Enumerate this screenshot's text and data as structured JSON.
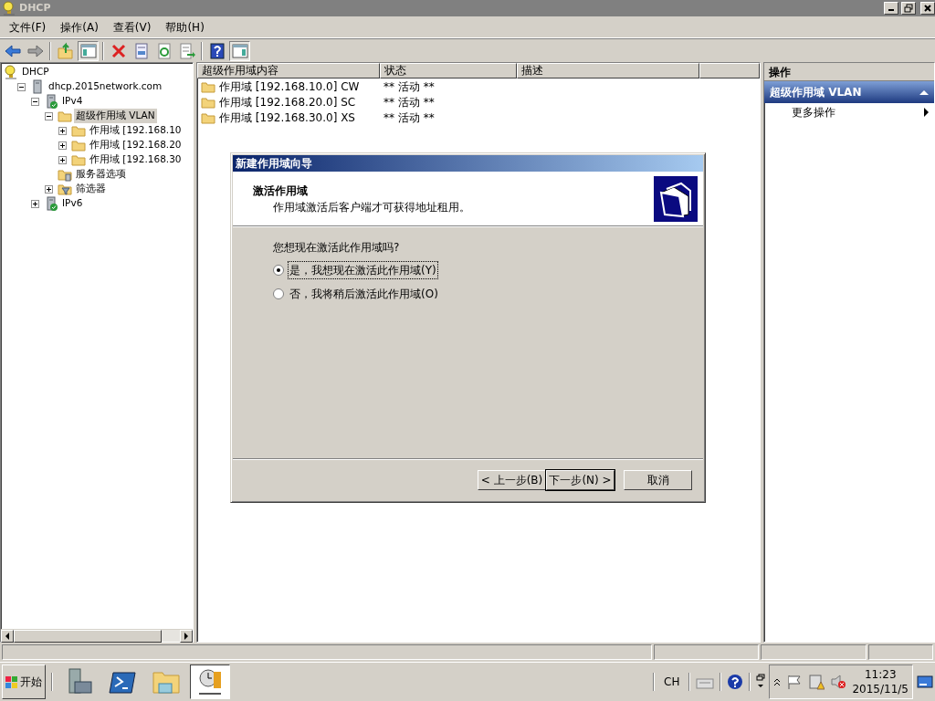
{
  "window": {
    "title": "DHCP"
  },
  "menu": [
    "文件(F)",
    "操作(A)",
    "查看(V)",
    "帮助(H)"
  ],
  "toolbar": [
    {
      "kind": "back",
      "pressed": false
    },
    {
      "kind": "forward",
      "pressed": false
    },
    {
      "kind": "sep"
    },
    {
      "kind": "up",
      "pressed": false
    },
    {
      "kind": "tree",
      "pressed": true
    },
    {
      "kind": "sep"
    },
    {
      "kind": "delete",
      "pressed": false
    },
    {
      "kind": "properties",
      "pressed": false
    },
    {
      "kind": "refresh",
      "pressed": false
    },
    {
      "kind": "export",
      "pressed": false
    },
    {
      "kind": "sep"
    },
    {
      "kind": "help",
      "pressed": false
    },
    {
      "kind": "actionpane",
      "pressed": true
    }
  ],
  "tree": [
    {
      "label": "DHCP",
      "kind": "dhcp",
      "selected": false,
      "children": [
        {
          "label": "dhcp.2015network.com",
          "kind": "server",
          "expanded": true,
          "selected": false,
          "children": [
            {
              "label": "IPv4",
              "kind": "serverok",
              "expanded": true,
              "selected": false,
              "children": [
                {
                  "label": "超级作用域 VLAN",
                  "kind": "folder",
                  "expanded": true,
                  "selected": true,
                  "children": [
                    {
                      "label": "作用域 [192.168.10",
                      "kind": "folder",
                      "expanded": false,
                      "selected": false
                    },
                    {
                      "label": "作用域 [192.168.20",
                      "kind": "folder",
                      "expanded": false,
                      "selected": false
                    },
                    {
                      "label": "作用域 [192.168.30",
                      "kind": "folder",
                      "expanded": false,
                      "selected": false
                    }
                  ]
                },
                {
                  "label": "服务器选项",
                  "kind": "options",
                  "selected": false
                },
                {
                  "label": "筛选器",
                  "kind": "filter",
                  "expanded": false,
                  "selected": false
                }
              ]
            },
            {
              "label": "IPv6",
              "kind": "serverok",
              "expanded": false,
              "selected": false
            }
          ]
        }
      ]
    }
  ],
  "list": {
    "columns": [
      "超级作用域内容",
      "状态",
      "描述"
    ],
    "rows": [
      {
        "name": "作用域 [192.168.10.0] CW",
        "status": "** 活动 **"
      },
      {
        "name": "作用域 [192.168.20.0] SC",
        "status": "** 活动 **"
      },
      {
        "name": "作用域 [192.168.30.0] XS",
        "status": "** 活动 **"
      }
    ]
  },
  "actions": {
    "title": "操作",
    "sections": [
      {
        "title": "超级作用域 VLAN",
        "expanded": true,
        "items": [
          "更多操作"
        ]
      }
    ]
  },
  "dialog": {
    "title": "新建作用域向导",
    "heading": "激活作用域",
    "subtitle": "作用域激活后客户端才可获得地址租用。",
    "question": "您想现在激活此作用域吗?",
    "options": [
      {
        "label": "是，我想现在激活此作用域(Y)",
        "selected": true,
        "focused": true
      },
      {
        "label": "否，我将稍后激活此作用域(O)",
        "selected": false,
        "focused": false
      }
    ],
    "buttons": [
      {
        "label": "< 上一步(B)",
        "default": false
      },
      {
        "label": "下一步(N) >",
        "default": true
      },
      {
        "label": "取消",
        "default": false
      }
    ]
  },
  "taskbar": {
    "start": "开始",
    "apps": [
      {
        "kind": "servermanager",
        "selected": false
      },
      {
        "kind": "powershell",
        "selected": false
      },
      {
        "kind": "explorer",
        "selected": false
      },
      {
        "kind": "dhcp",
        "selected": true
      }
    ],
    "language": "CH",
    "time": "11:23",
    "date": "2015/11/5"
  }
}
